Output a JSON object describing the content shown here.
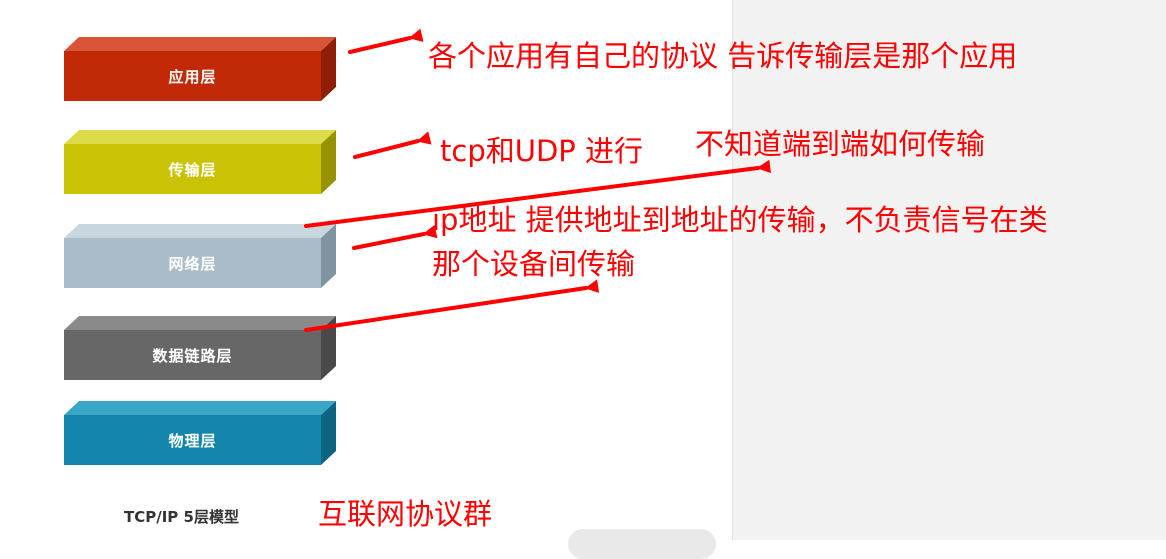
{
  "layers": [
    {
      "label": "应用层",
      "front": "#c22a07",
      "top": "#d95436",
      "side": "#8e1e05"
    },
    {
      "label": "传输层",
      "front": "#c9c205",
      "top": "#dedb4a",
      "side": "#979104"
    },
    {
      "label": "网络层",
      "front": "#a9bcc8",
      "top": "#c8d6df",
      "side": "#7f949f"
    },
    {
      "label": "数据链路层",
      "front": "#676768",
      "top": "#8a8a8b",
      "side": "#49494a"
    },
    {
      "label": "物理层",
      "front": "#1486ab",
      "top": "#3aa6c7",
      "side": "#0d6481"
    }
  ],
  "annotations": {
    "application": "各个应用有自己的协议  告诉传输层是那个应用",
    "transport": "tcp和UDP 进行",
    "end_to_end": "不知道端到端如何传输",
    "network_line1": "ip地址 提供地址到地址的传输，不负责信号在类",
    "network_line2": "那个设备间传输"
  },
  "caption": "TCP/IP 5层模型",
  "caption_note": "互联网协议群",
  "colors": {
    "annotation": "#ff0000"
  }
}
